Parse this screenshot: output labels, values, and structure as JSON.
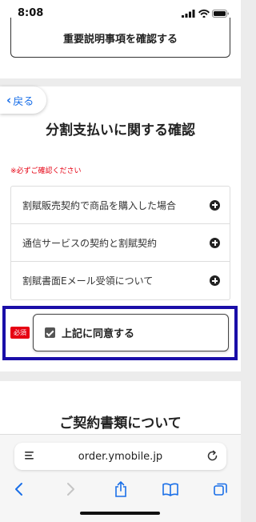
{
  "status_bar": {
    "time": "8:08"
  },
  "explain_button_label": "重要説明事項を確認する",
  "back_button_label": "戻る",
  "main_title": "分割支払いに関する確認",
  "note": "※必ずご確認ください",
  "accordion_items": [
    {
      "label": "割賦販売契約で商品を購入した場合",
      "icon": "plus-circle-icon"
    },
    {
      "label": "通信サービスの契約と割賦契約",
      "icon": "plus-circle-icon"
    },
    {
      "label": "割賦書面Eメール受領について",
      "icon": "plus-circle-icon"
    }
  ],
  "agreement": {
    "required_badge": "必須",
    "label": "上記に同意する",
    "checked": true
  },
  "contract_title": "ご契約書類について",
  "browser": {
    "url": "order.ymobile.jp"
  },
  "colors": {
    "accent_red": "#e60012",
    "link_blue": "#1a6fe8",
    "highlight_frame": "#1a0ea8"
  }
}
